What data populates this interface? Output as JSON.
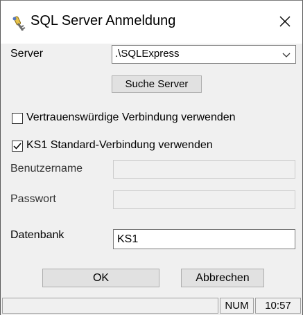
{
  "window": {
    "title": "SQL Server Anmeldung",
    "title_icon": "key-wrench-icon",
    "close_icon": "close-icon"
  },
  "form": {
    "server_label": "Server",
    "server_value": ".\\SQLExpress",
    "server_dropdown_icon": "chevron-down-icon",
    "search_server_label": "Suche Server",
    "trusted_connection_label": "Vertrauenswürdige Verbindung verwenden",
    "trusted_connection_checked": false,
    "ks1_standard_label": "KS1 Standard-Verbindung verwenden",
    "ks1_standard_checked": true,
    "username_label": "Benutzername",
    "username_value": "",
    "password_label": "Passwort",
    "password_value": "",
    "database_label": "Datenbank",
    "database_value": "KS1"
  },
  "buttons": {
    "ok_label": "OK",
    "cancel_label": "Abbrechen"
  },
  "statusbar": {
    "num_label": "NUM",
    "time": "10:57"
  }
}
